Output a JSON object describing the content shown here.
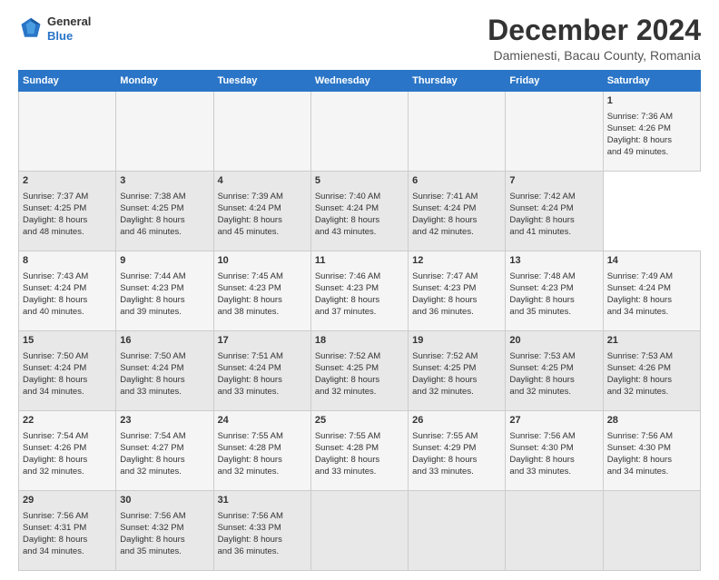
{
  "header": {
    "logo_line1": "General",
    "logo_line2": "Blue",
    "title": "December 2024",
    "subtitle": "Damienesti, Bacau County, Romania"
  },
  "calendar": {
    "days_of_week": [
      "Sunday",
      "Monday",
      "Tuesday",
      "Wednesday",
      "Thursday",
      "Friday",
      "Saturday"
    ],
    "weeks": [
      [
        {
          "day": "",
          "content": ""
        },
        {
          "day": "",
          "content": ""
        },
        {
          "day": "",
          "content": ""
        },
        {
          "day": "",
          "content": ""
        },
        {
          "day": "",
          "content": ""
        },
        {
          "day": "",
          "content": ""
        },
        {
          "day": "1",
          "content": "Sunrise: 7:36 AM\nSunset: 4:26 PM\nDaylight: 8 hours\nand 49 minutes."
        }
      ],
      [
        {
          "day": "2",
          "content": "Sunrise: 7:37 AM\nSunset: 4:25 PM\nDaylight: 8 hours\nand 48 minutes."
        },
        {
          "day": "3",
          "content": "Sunrise: 7:38 AM\nSunset: 4:25 PM\nDaylight: 8 hours\nand 46 minutes."
        },
        {
          "day": "4",
          "content": "Sunrise: 7:39 AM\nSunset: 4:24 PM\nDaylight: 8 hours\nand 45 minutes."
        },
        {
          "day": "5",
          "content": "Sunrise: 7:40 AM\nSunset: 4:24 PM\nDaylight: 8 hours\nand 43 minutes."
        },
        {
          "day": "6",
          "content": "Sunrise: 7:41 AM\nSunset: 4:24 PM\nDaylight: 8 hours\nand 42 minutes."
        },
        {
          "day": "7",
          "content": "Sunrise: 7:42 AM\nSunset: 4:24 PM\nDaylight: 8 hours\nand 41 minutes."
        }
      ],
      [
        {
          "day": "8",
          "content": "Sunrise: 7:43 AM\nSunset: 4:24 PM\nDaylight: 8 hours\nand 40 minutes."
        },
        {
          "day": "9",
          "content": "Sunrise: 7:44 AM\nSunset: 4:23 PM\nDaylight: 8 hours\nand 39 minutes."
        },
        {
          "day": "10",
          "content": "Sunrise: 7:45 AM\nSunset: 4:23 PM\nDaylight: 8 hours\nand 38 minutes."
        },
        {
          "day": "11",
          "content": "Sunrise: 7:46 AM\nSunset: 4:23 PM\nDaylight: 8 hours\nand 37 minutes."
        },
        {
          "day": "12",
          "content": "Sunrise: 7:47 AM\nSunset: 4:23 PM\nDaylight: 8 hours\nand 36 minutes."
        },
        {
          "day": "13",
          "content": "Sunrise: 7:48 AM\nSunset: 4:23 PM\nDaylight: 8 hours\nand 35 minutes."
        },
        {
          "day": "14",
          "content": "Sunrise: 7:49 AM\nSunset: 4:24 PM\nDaylight: 8 hours\nand 34 minutes."
        }
      ],
      [
        {
          "day": "15",
          "content": "Sunrise: 7:50 AM\nSunset: 4:24 PM\nDaylight: 8 hours\nand 34 minutes."
        },
        {
          "day": "16",
          "content": "Sunrise: 7:50 AM\nSunset: 4:24 PM\nDaylight: 8 hours\nand 33 minutes."
        },
        {
          "day": "17",
          "content": "Sunrise: 7:51 AM\nSunset: 4:24 PM\nDaylight: 8 hours\nand 33 minutes."
        },
        {
          "day": "18",
          "content": "Sunrise: 7:52 AM\nSunset: 4:25 PM\nDaylight: 8 hours\nand 32 minutes."
        },
        {
          "day": "19",
          "content": "Sunrise: 7:52 AM\nSunset: 4:25 PM\nDaylight: 8 hours\nand 32 minutes."
        },
        {
          "day": "20",
          "content": "Sunrise: 7:53 AM\nSunset: 4:25 PM\nDaylight: 8 hours\nand 32 minutes."
        },
        {
          "day": "21",
          "content": "Sunrise: 7:53 AM\nSunset: 4:26 PM\nDaylight: 8 hours\nand 32 minutes."
        }
      ],
      [
        {
          "day": "22",
          "content": "Sunrise: 7:54 AM\nSunset: 4:26 PM\nDaylight: 8 hours\nand 32 minutes."
        },
        {
          "day": "23",
          "content": "Sunrise: 7:54 AM\nSunset: 4:27 PM\nDaylight: 8 hours\nand 32 minutes."
        },
        {
          "day": "24",
          "content": "Sunrise: 7:55 AM\nSunset: 4:28 PM\nDaylight: 8 hours\nand 32 minutes."
        },
        {
          "day": "25",
          "content": "Sunrise: 7:55 AM\nSunset: 4:28 PM\nDaylight: 8 hours\nand 33 minutes."
        },
        {
          "day": "26",
          "content": "Sunrise: 7:55 AM\nSunset: 4:29 PM\nDaylight: 8 hours\nand 33 minutes."
        },
        {
          "day": "27",
          "content": "Sunrise: 7:56 AM\nSunset: 4:30 PM\nDaylight: 8 hours\nand 33 minutes."
        },
        {
          "day": "28",
          "content": "Sunrise: 7:56 AM\nSunset: 4:30 PM\nDaylight: 8 hours\nand 34 minutes."
        }
      ],
      [
        {
          "day": "29",
          "content": "Sunrise: 7:56 AM\nSunset: 4:31 PM\nDaylight: 8 hours\nand 34 minutes."
        },
        {
          "day": "30",
          "content": "Sunrise: 7:56 AM\nSunset: 4:32 PM\nDaylight: 8 hours\nand 35 minutes."
        },
        {
          "day": "31",
          "content": "Sunrise: 7:56 AM\nSunset: 4:33 PM\nDaylight: 8 hours\nand 36 minutes."
        },
        {
          "day": "",
          "content": ""
        },
        {
          "day": "",
          "content": ""
        },
        {
          "day": "",
          "content": ""
        },
        {
          "day": "",
          "content": ""
        }
      ]
    ]
  }
}
